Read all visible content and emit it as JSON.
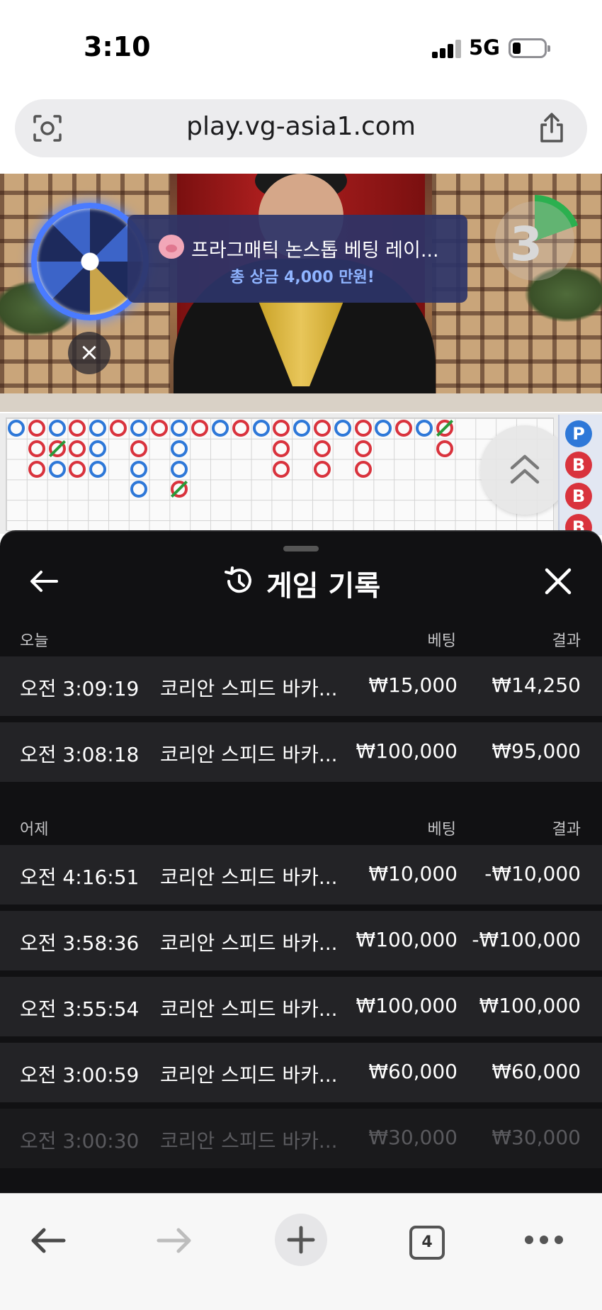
{
  "status_bar": {
    "time": "3:10",
    "network": "5G"
  },
  "browser": {
    "url": "play.vg-asia1.com",
    "tab_count": "4"
  },
  "video": {
    "promo_title": "프라그매틱 논스톱 베팅 레이...",
    "promo_subtitle": "총 상금 4,000 만원!",
    "countdown": "3",
    "close_symbol": "×"
  },
  "road_side": [
    "P",
    "B",
    "B",
    "B"
  ],
  "panel": {
    "title": "게임 기록",
    "sections": [
      {
        "label": "오늘",
        "bet_header": "베팅",
        "result_header": "결과",
        "rows": [
          {
            "time": "오전 3:09:19",
            "game": "코리안 스피드 바카...",
            "bet": "₩15,000",
            "result": "₩14,250"
          },
          {
            "time": "오전 3:08:18",
            "game": "코리안 스피드 바카...",
            "bet": "₩100,000",
            "result": "₩95,000"
          }
        ]
      },
      {
        "label": "어제",
        "bet_header": "베팅",
        "result_header": "결과",
        "rows": [
          {
            "time": "오전 4:16:51",
            "game": "코리안 스피드 바카...",
            "bet": "₩10,000",
            "result": "-₩10,000"
          },
          {
            "time": "오전 3:58:36",
            "game": "코리안 스피드 바카...",
            "bet": "₩100,000",
            "result": "-₩100,000"
          },
          {
            "time": "오전 3:55:54",
            "game": "코리안 스피드 바카...",
            "bet": "₩100,000",
            "result": "₩100,000"
          },
          {
            "time": "오전 3:00:59",
            "game": "코리안 스피드 바카...",
            "bet": "₩60,000",
            "result": "₩60,000"
          },
          {
            "time": "오전 3:00:30",
            "game": "코리안 스피드 바카...",
            "bet": "₩30,000",
            "result": "₩30,000"
          }
        ]
      }
    ]
  },
  "colors": {
    "banker": "#d9333d",
    "player": "#2e78d8",
    "tie": "#2a9a3a",
    "panel_bg": "#111113",
    "row_bg": "#232326"
  }
}
